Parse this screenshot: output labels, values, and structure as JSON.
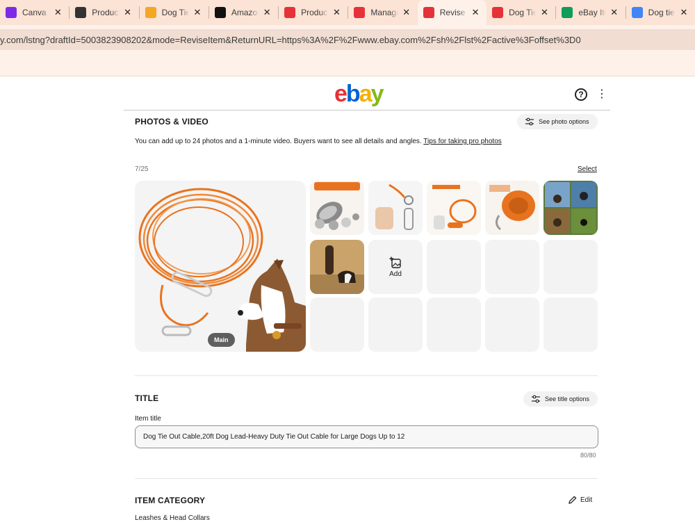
{
  "browser": {
    "tabs": [
      {
        "label": "Canva B",
        "icon": "canva-icon",
        "color": "#7d2ae8"
      },
      {
        "label": "Product",
        "icon": "openai-icon",
        "color": "#333333"
      },
      {
        "label": "Dog Tie",
        "icon": "bolt-icon",
        "color": "#f5a623"
      },
      {
        "label": "Amazon",
        "icon": "amazon-icon",
        "color": "#111111"
      },
      {
        "label": "Product",
        "icon": "ebay-bag-icon",
        "color": "#e53238"
      },
      {
        "label": "Manage",
        "icon": "ebay-bag-icon",
        "color": "#e53238"
      },
      {
        "label": "Revise y",
        "icon": "ebay-bag-icon",
        "color": "#e53238",
        "active": true
      },
      {
        "label": "Dog Tie",
        "icon": "ebay-bag-icon",
        "color": "#e53238"
      },
      {
        "label": "eBay Ite",
        "icon": "sheets-icon",
        "color": "#0f9d58"
      },
      {
        "label": "Dog tie",
        "icon": "google-icon",
        "color": "#4285f4"
      }
    ],
    "url": "y.com/lstng?draftId=5003823908202&mode=ReviseItem&ReturnURL=https%3A%2F%2Fwww.ebay.com%2Fsh%2Flst%2Factive%3Foffset%3D0"
  },
  "header": {
    "logo": [
      "e",
      "b",
      "a",
      "y"
    ],
    "help_glyph": "?",
    "more_glyph": "⋮"
  },
  "photos": {
    "title": "PHOTOS & VIDEO",
    "options_label": "See photo options",
    "description": "You can add up to 24 photos and a 1-minute video. Buyers want to see all details and angles. ",
    "tips_link": "Tips for taking pro photos",
    "count": "7/25",
    "select_label": "Select",
    "main_badge": "Main",
    "add_label": "Add"
  },
  "title_section": {
    "title": "TITLE",
    "options_label": "See title options",
    "field_label": "Item title",
    "value": "Dog Tie Out Cable,20ft Dog Lead-Heavy Duty Tie Out Cable for Large Dogs Up to 12",
    "char_count": "80/80"
  },
  "category": {
    "title": "ITEM CATEGORY",
    "edit_label": "Edit",
    "value": "Leashes & Head Collars"
  },
  "colors": {
    "accent_orange": "#e8731f",
    "tab_bar": "#fbe3d5"
  }
}
